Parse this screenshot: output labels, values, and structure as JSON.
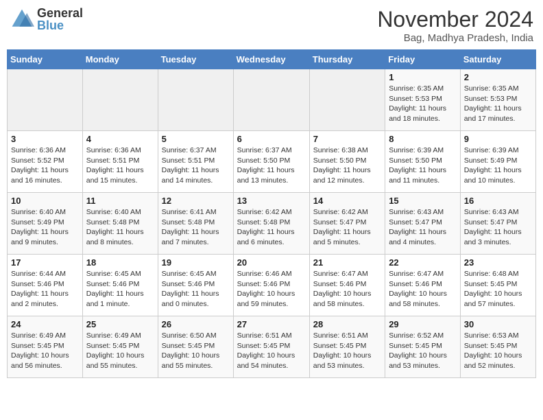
{
  "header": {
    "logo_line1": "General",
    "logo_line2": "Blue",
    "month": "November 2024",
    "location": "Bag, Madhya Pradesh, India"
  },
  "weekdays": [
    "Sunday",
    "Monday",
    "Tuesday",
    "Wednesday",
    "Thursday",
    "Friday",
    "Saturday"
  ],
  "weeks": [
    [
      {
        "day": "",
        "info": ""
      },
      {
        "day": "",
        "info": ""
      },
      {
        "day": "",
        "info": ""
      },
      {
        "day": "",
        "info": ""
      },
      {
        "day": "",
        "info": ""
      },
      {
        "day": "1",
        "info": "Sunrise: 6:35 AM\nSunset: 5:53 PM\nDaylight: 11 hours and 18 minutes."
      },
      {
        "day": "2",
        "info": "Sunrise: 6:35 AM\nSunset: 5:53 PM\nDaylight: 11 hours and 17 minutes."
      }
    ],
    [
      {
        "day": "3",
        "info": "Sunrise: 6:36 AM\nSunset: 5:52 PM\nDaylight: 11 hours and 16 minutes."
      },
      {
        "day": "4",
        "info": "Sunrise: 6:36 AM\nSunset: 5:51 PM\nDaylight: 11 hours and 15 minutes."
      },
      {
        "day": "5",
        "info": "Sunrise: 6:37 AM\nSunset: 5:51 PM\nDaylight: 11 hours and 14 minutes."
      },
      {
        "day": "6",
        "info": "Sunrise: 6:37 AM\nSunset: 5:50 PM\nDaylight: 11 hours and 13 minutes."
      },
      {
        "day": "7",
        "info": "Sunrise: 6:38 AM\nSunset: 5:50 PM\nDaylight: 11 hours and 12 minutes."
      },
      {
        "day": "8",
        "info": "Sunrise: 6:39 AM\nSunset: 5:50 PM\nDaylight: 11 hours and 11 minutes."
      },
      {
        "day": "9",
        "info": "Sunrise: 6:39 AM\nSunset: 5:49 PM\nDaylight: 11 hours and 10 minutes."
      }
    ],
    [
      {
        "day": "10",
        "info": "Sunrise: 6:40 AM\nSunset: 5:49 PM\nDaylight: 11 hours and 9 minutes."
      },
      {
        "day": "11",
        "info": "Sunrise: 6:40 AM\nSunset: 5:48 PM\nDaylight: 11 hours and 8 minutes."
      },
      {
        "day": "12",
        "info": "Sunrise: 6:41 AM\nSunset: 5:48 PM\nDaylight: 11 hours and 7 minutes."
      },
      {
        "day": "13",
        "info": "Sunrise: 6:42 AM\nSunset: 5:48 PM\nDaylight: 11 hours and 6 minutes."
      },
      {
        "day": "14",
        "info": "Sunrise: 6:42 AM\nSunset: 5:47 PM\nDaylight: 11 hours and 5 minutes."
      },
      {
        "day": "15",
        "info": "Sunrise: 6:43 AM\nSunset: 5:47 PM\nDaylight: 11 hours and 4 minutes."
      },
      {
        "day": "16",
        "info": "Sunrise: 6:43 AM\nSunset: 5:47 PM\nDaylight: 11 hours and 3 minutes."
      }
    ],
    [
      {
        "day": "17",
        "info": "Sunrise: 6:44 AM\nSunset: 5:46 PM\nDaylight: 11 hours and 2 minutes."
      },
      {
        "day": "18",
        "info": "Sunrise: 6:45 AM\nSunset: 5:46 PM\nDaylight: 11 hours and 1 minute."
      },
      {
        "day": "19",
        "info": "Sunrise: 6:45 AM\nSunset: 5:46 PM\nDaylight: 11 hours and 0 minutes."
      },
      {
        "day": "20",
        "info": "Sunrise: 6:46 AM\nSunset: 5:46 PM\nDaylight: 10 hours and 59 minutes."
      },
      {
        "day": "21",
        "info": "Sunrise: 6:47 AM\nSunset: 5:46 PM\nDaylight: 10 hours and 58 minutes."
      },
      {
        "day": "22",
        "info": "Sunrise: 6:47 AM\nSunset: 5:46 PM\nDaylight: 10 hours and 58 minutes."
      },
      {
        "day": "23",
        "info": "Sunrise: 6:48 AM\nSunset: 5:45 PM\nDaylight: 10 hours and 57 minutes."
      }
    ],
    [
      {
        "day": "24",
        "info": "Sunrise: 6:49 AM\nSunset: 5:45 PM\nDaylight: 10 hours and 56 minutes."
      },
      {
        "day": "25",
        "info": "Sunrise: 6:49 AM\nSunset: 5:45 PM\nDaylight: 10 hours and 55 minutes."
      },
      {
        "day": "26",
        "info": "Sunrise: 6:50 AM\nSunset: 5:45 PM\nDaylight: 10 hours and 55 minutes."
      },
      {
        "day": "27",
        "info": "Sunrise: 6:51 AM\nSunset: 5:45 PM\nDaylight: 10 hours and 54 minutes."
      },
      {
        "day": "28",
        "info": "Sunrise: 6:51 AM\nSunset: 5:45 PM\nDaylight: 10 hours and 53 minutes."
      },
      {
        "day": "29",
        "info": "Sunrise: 6:52 AM\nSunset: 5:45 PM\nDaylight: 10 hours and 53 minutes."
      },
      {
        "day": "30",
        "info": "Sunrise: 6:53 AM\nSunset: 5:45 PM\nDaylight: 10 hours and 52 minutes."
      }
    ]
  ]
}
